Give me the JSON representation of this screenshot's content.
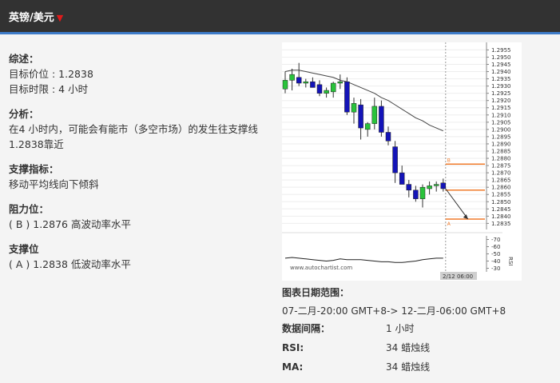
{
  "header": {
    "title": "英镑/美元",
    "arrow": "▼"
  },
  "summary": {
    "title": "综述：",
    "target_level": "目标价位 : 1.2838",
    "target_period": "目标时限 : 4 小时"
  },
  "analysis": {
    "title": "分析：",
    "text": "在4 小时内，可能会有能市（多空市场）的发生往支撑线1.2838靠近"
  },
  "indicator": {
    "title": "支撑指标：",
    "text": "移动平均线向下倾斜"
  },
  "resistance": {
    "title": "阻力位：",
    "text": "( B ) 1.2876 高波动率水平"
  },
  "support": {
    "title": "支撑位",
    "text": "( A ) 1.2838 低波动率水平"
  },
  "chart_info": {
    "range_label": "图表日期范围：",
    "range_value": "07-二月-20:00 GMT+8-> 12-二月-06:00 GMT+8",
    "interval_label": "数据间隔：",
    "interval_value": "1 小时",
    "rsi_label": "RSI:",
    "rsi_value": "34 蜡烛线",
    "ma_label": "MA:",
    "ma_value": "34 蜡烛线"
  },
  "colors": {
    "up": "#29c33b",
    "down": "#1414b8",
    "level": "#f07c2c",
    "header": "#323232",
    "accent": "#3d7bc8"
  },
  "chart_data": {
    "type": "candlestick",
    "ylim": [
      1.2833,
      1.2958
    ],
    "yticks": [
      "1.2955",
      "1.2950",
      "1.2945",
      "1.2940",
      "1.2935",
      "1.2930",
      "1.2925",
      "1.2920",
      "1.2915",
      "1.2910",
      "1.2905",
      "1.2900",
      "1.2895",
      "1.2890",
      "1.2885",
      "1.2880",
      "1.2875",
      "1.2870",
      "1.2865",
      "1.2860",
      "1.2855",
      "1.2850",
      "1.2845",
      "1.2840",
      "1.2835"
    ],
    "candles": [
      {
        "o": 1.2928,
        "h": 1.294,
        "l": 1.2925,
        "c": 1.2934
      },
      {
        "o": 1.2934,
        "h": 1.2942,
        "l": 1.2927,
        "c": 1.2938
      },
      {
        "o": 1.2936,
        "h": 1.2946,
        "l": 1.293,
        "c": 1.2932
      },
      {
        "o": 1.2932,
        "h": 1.2935,
        "l": 1.2929,
        "c": 1.2933
      },
      {
        "o": 1.2933,
        "h": 1.2936,
        "l": 1.2929,
        "c": 1.2929
      },
      {
        "o": 1.2931,
        "h": 1.2934,
        "l": 1.2923,
        "c": 1.2925
      },
      {
        "o": 1.2925,
        "h": 1.2929,
        "l": 1.2922,
        "c": 1.2927
      },
      {
        "o": 1.2926,
        "h": 1.2933,
        "l": 1.2922,
        "c": 1.2932
      },
      {
        "o": 1.2932,
        "h": 1.2938,
        "l": 1.2928,
        "c": 1.2933
      },
      {
        "o": 1.2933,
        "h": 1.2936,
        "l": 1.291,
        "c": 1.2912
      },
      {
        "o": 1.2912,
        "h": 1.2922,
        "l": 1.2904,
        "c": 1.2918
      },
      {
        "o": 1.2917,
        "h": 1.2921,
        "l": 1.2893,
        "c": 1.2901
      },
      {
        "o": 1.29,
        "h": 1.2905,
        "l": 1.2895,
        "c": 1.2904
      },
      {
        "o": 1.2904,
        "h": 1.2922,
        "l": 1.29,
        "c": 1.2916
      },
      {
        "o": 1.2916,
        "h": 1.292,
        "l": 1.2895,
        "c": 1.2898
      },
      {
        "o": 1.2898,
        "h": 1.2902,
        "l": 1.2889,
        "c": 1.2892
      },
      {
        "o": 1.2888,
        "h": 1.2892,
        "l": 1.2863,
        "c": 1.287
      },
      {
        "o": 1.287,
        "h": 1.2875,
        "l": 1.2862,
        "c": 1.2862
      },
      {
        "o": 1.2862,
        "h": 1.2865,
        "l": 1.2853,
        "c": 1.2858
      },
      {
        "o": 1.2858,
        "h": 1.2861,
        "l": 1.285,
        "c": 1.2852
      },
      {
        "o": 1.2852,
        "h": 1.2862,
        "l": 1.2846,
        "c": 1.286
      },
      {
        "o": 1.2859,
        "h": 1.2864,
        "l": 1.2855,
        "c": 1.2861
      },
      {
        "o": 1.2861,
        "h": 1.2864,
        "l": 1.2857,
        "c": 1.2862
      },
      {
        "o": 1.2863,
        "h": 1.2866,
        "l": 1.2857,
        "c": 1.2859
      }
    ],
    "ma": [
      1.294,
      1.2941,
      1.2941,
      1.294,
      1.2939,
      1.2938,
      1.2937,
      1.2936,
      1.2934,
      1.2933,
      1.2931,
      1.2929,
      1.2927,
      1.2925,
      1.2922,
      1.292,
      1.2917,
      1.2914,
      1.2911,
      1.2908,
      1.2906,
      1.2903,
      1.2901,
      1.2899
    ],
    "levels": [
      {
        "label": "B",
        "value": 1.2876
      },
      {
        "label": "A",
        "value": 1.2838
      },
      {
        "label": "",
        "value": 1.2858
      }
    ],
    "rsi": {
      "yticks": [
        "70",
        "60",
        "50",
        "40",
        "30"
      ],
      "ylim": [
        25,
        75
      ],
      "values": [
        44,
        45,
        44,
        43,
        42,
        41,
        40,
        41,
        43,
        42,
        42,
        42,
        41,
        40,
        39,
        39,
        38,
        38,
        39,
        40,
        42,
        43,
        44,
        44
      ]
    },
    "watermark": "www.autochartist.com",
    "time_label": "2/12 06:00"
  }
}
